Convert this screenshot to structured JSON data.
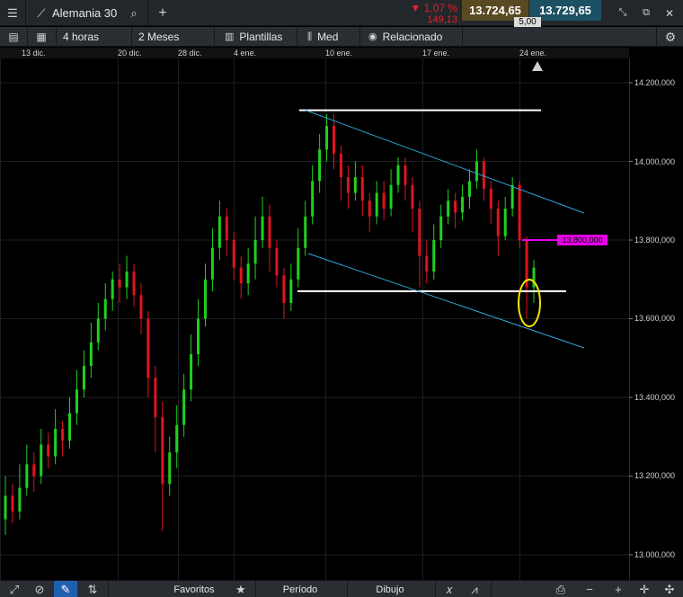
{
  "top": {
    "instrument": "Alemania 30",
    "change_pct": "▼ 1,07 %",
    "change_abs": "149,13",
    "sell_price": "13.724,65",
    "buy_price": "13.729,65",
    "spread": "5,00",
    "colors": {
      "sell_bg": "#5a4a22",
      "buy_bg": "#1c5163",
      "down": "#e2202f"
    }
  },
  "toolbar": {
    "interval": "4 horas",
    "range": "2 Meses",
    "templates": "Plantillas",
    "chart_style": "Med",
    "related": "Relacionado"
  },
  "date_axis": [
    "13 dic.",
    "20 dic.",
    "28 dic.",
    "4 ene.",
    "10 ene.",
    "17 ene.",
    "24 ene."
  ],
  "price_axis": [
    "14.200,000",
    "14.000,000",
    "13.800,000",
    "13.600,000",
    "13.400,000",
    "13.200,000",
    "13.000,000"
  ],
  "price_flag": "13.800,000",
  "bottom": {
    "favorites": "Favoritos",
    "period": "Período",
    "drawing": "Dibujo"
  },
  "chart_data": {
    "type": "candlestick",
    "instrument": "Alemania 30",
    "timeframe": "4 horas",
    "xlabels": [
      "13 dic.",
      "20 dic.",
      "28 dic.",
      "4 ene.",
      "10 ene.",
      "17 ene.",
      "24 ene."
    ],
    "ylim": [
      12970,
      14245
    ],
    "yticks": [
      13000,
      13200,
      13400,
      13600,
      13800,
      14000,
      14200
    ],
    "colors": {
      "up": "#1fd11f",
      "down": "#e0141e"
    },
    "candles": [
      [
        13090,
        13150,
        13050,
        13200
      ],
      [
        13150,
        13110,
        13080,
        13180
      ],
      [
        13110,
        13170,
        13090,
        13230
      ],
      [
        13170,
        13230,
        13150,
        13280
      ],
      [
        13230,
        13200,
        13160,
        13260
      ],
      [
        13200,
        13280,
        13180,
        13320
      ],
      [
        13280,
        13250,
        13220,
        13310
      ],
      [
        13250,
        13320,
        13230,
        13370
      ],
      [
        13320,
        13290,
        13250,
        13340
      ],
      [
        13290,
        13360,
        13270,
        13400
      ],
      [
        13360,
        13420,
        13330,
        13470
      ],
      [
        13420,
        13480,
        13400,
        13520
      ],
      [
        13480,
        13540,
        13450,
        13590
      ],
      [
        13540,
        13600,
        13520,
        13640
      ],
      [
        13600,
        13650,
        13570,
        13690
      ],
      [
        13650,
        13700,
        13620,
        13720
      ],
      [
        13700,
        13680,
        13640,
        13740
      ],
      [
        13680,
        13720,
        13650,
        13760
      ],
      [
        13720,
        13660,
        13630,
        13740
      ],
      [
        13660,
        13600,
        13560,
        13690
      ],
      [
        13600,
        13450,
        13400,
        13620
      ],
      [
        13450,
        13350,
        13260,
        13480
      ],
      [
        13350,
        13180,
        13060,
        13390
      ],
      [
        13180,
        13260,
        13150,
        13300
      ],
      [
        13260,
        13330,
        13220,
        13380
      ],
      [
        13330,
        13420,
        13300,
        13460
      ],
      [
        13420,
        13510,
        13390,
        13560
      ],
      [
        13510,
        13600,
        13480,
        13650
      ],
      [
        13600,
        13700,
        13580,
        13740
      ],
      [
        13700,
        13780,
        13670,
        13830
      ],
      [
        13780,
        13860,
        13750,
        13900
      ],
      [
        13860,
        13800,
        13760,
        13880
      ],
      [
        13800,
        13730,
        13700,
        13820
      ],
      [
        13730,
        13690,
        13650,
        13760
      ],
      [
        13690,
        13740,
        13660,
        13780
      ],
      [
        13740,
        13800,
        13700,
        13860
      ],
      [
        13800,
        13860,
        13780,
        13910
      ],
      [
        13860,
        13780,
        13720,
        13890
      ],
      [
        13780,
        13710,
        13680,
        13800
      ],
      [
        13710,
        13640,
        13600,
        13730
      ],
      [
        13640,
        13700,
        13620,
        13740
      ],
      [
        13700,
        13780,
        13680,
        13830
      ],
      [
        13780,
        13860,
        13760,
        13900
      ],
      [
        13860,
        13950,
        13840,
        13990
      ],
      [
        13950,
        14030,
        13920,
        14070
      ],
      [
        14030,
        14090,
        14000,
        14120
      ],
      [
        14090,
        14020,
        13980,
        14120
      ],
      [
        14020,
        13960,
        13900,
        14040
      ],
      [
        13960,
        13920,
        13880,
        13990
      ],
      [
        13920,
        13960,
        13900,
        14000
      ],
      [
        13960,
        13900,
        13860,
        13990
      ],
      [
        13900,
        13860,
        13820,
        13920
      ],
      [
        13860,
        13920,
        13840,
        13950
      ],
      [
        13920,
        13880,
        13850,
        13950
      ],
      [
        13880,
        13940,
        13860,
        13980
      ],
      [
        13940,
        13990,
        13920,
        14010
      ],
      [
        13990,
        13940,
        13900,
        14010
      ],
      [
        13940,
        13880,
        13820,
        13960
      ],
      [
        13880,
        13760,
        13680,
        13900
      ],
      [
        13760,
        13720,
        13690,
        13800
      ],
      [
        13720,
        13800,
        13700,
        13840
      ],
      [
        13800,
        13860,
        13780,
        13890
      ],
      [
        13860,
        13900,
        13840,
        13930
      ],
      [
        13900,
        13870,
        13830,
        13920
      ],
      [
        13870,
        13910,
        13850,
        13940
      ],
      [
        13910,
        13950,
        13880,
        13980
      ],
      [
        13950,
        14000,
        13930,
        14030
      ],
      [
        14000,
        13930,
        13900,
        14010
      ],
      [
        13930,
        13880,
        13840,
        13950
      ],
      [
        13880,
        13810,
        13760,
        13900
      ],
      [
        13810,
        13880,
        13800,
        13910
      ],
      [
        13880,
        13940,
        13860,
        13960
      ],
      [
        13940,
        13800,
        13780,
        13950
      ],
      [
        13800,
        13680,
        13600,
        13810
      ],
      [
        13680,
        13730,
        13640,
        13750
      ]
    ],
    "overlays": {
      "horizontal_levels": [
        14130,
        13670
      ],
      "channel_upper": [
        [
          14130,
          13960
        ]
      ],
      "channel_lower": [
        [
          13720,
          13560
        ]
      ],
      "marker_level": 13800,
      "highlight": "ellipse-around-last-candles"
    }
  }
}
